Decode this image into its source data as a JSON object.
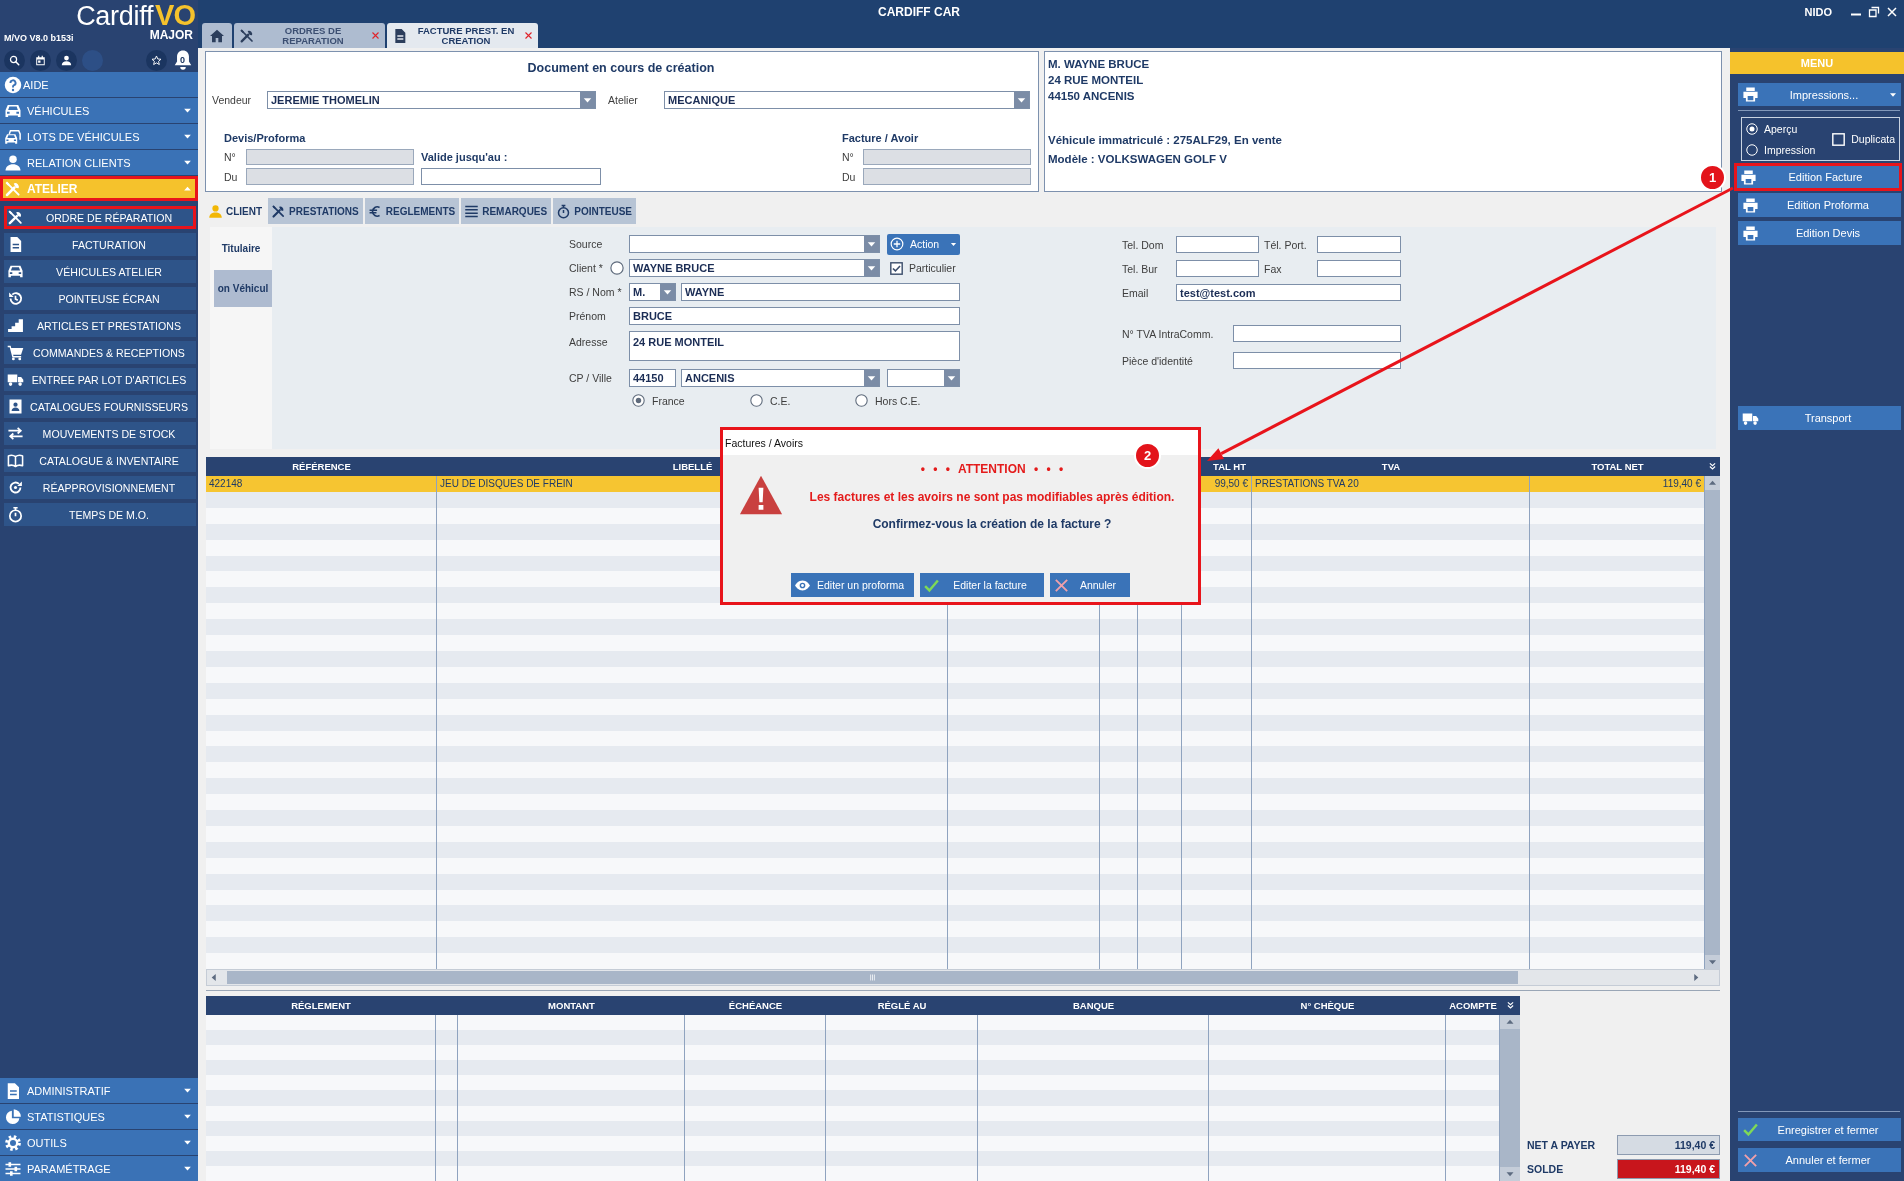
{
  "window": {
    "title": "CARDIFF CAR",
    "user": "NIDO"
  },
  "sidebar": {
    "logo": {
      "name": "Cardiff",
      "accent": "VO",
      "edition": "MAJOR"
    },
    "version": "M/VO V8.0 b153i",
    "notification_count": "0",
    "menu": [
      {
        "kind": "link",
        "label": "AIDE",
        "highlighted": false
      },
      {
        "kind": "group",
        "label": "VÉHICULES",
        "expanded": false,
        "highlighted": false
      },
      {
        "kind": "group",
        "label": "LOTS DE VÉHICULES",
        "expanded": false,
        "highlighted": false
      },
      {
        "kind": "group",
        "label": "RELATION CLIENTS",
        "expanded": false,
        "highlighted": false
      },
      {
        "kind": "group",
        "label": "ATELIER",
        "expanded": true,
        "highlighted": true,
        "children": [
          {
            "label": "ORDRE DE RÉPARATION",
            "highlighted": true
          },
          {
            "label": "FACTURATION",
            "highlighted": false
          },
          {
            "label": "VÉHICULES ATELIER",
            "highlighted": false
          },
          {
            "label": "POINTEUSE ÉCRAN",
            "highlighted": false
          },
          {
            "label": "ARTICLES ET PRESTATIONS",
            "highlighted": false
          },
          {
            "label": "COMMANDES & RECEPTIONS",
            "highlighted": false
          },
          {
            "label": "ENTREE PAR LOT D'ARTICLES",
            "highlighted": false
          },
          {
            "label": "CATALOGUES FOURNISSEURS",
            "highlighted": false
          },
          {
            "label": "MOUVEMENTS DE STOCK",
            "highlighted": false
          },
          {
            "label": "CATALOGUE & INVENTAIRE",
            "highlighted": false
          },
          {
            "label": "RÉAPPROVISIONNEMENT",
            "highlighted": false
          },
          {
            "label": "TEMPS DE M.O.",
            "highlighted": false
          }
        ]
      }
    ],
    "bottom_menu": [
      {
        "kind": "group",
        "label": "ADMINISTRATIF",
        "expanded": false,
        "highlighted": false
      },
      {
        "kind": "group",
        "label": "STATISTIQUES",
        "expanded": false,
        "highlighted": false
      },
      {
        "kind": "group",
        "label": "OUTILS",
        "expanded": false,
        "highlighted": false
      },
      {
        "kind": "group",
        "label": "PARAMÉTRAGE",
        "expanded": false,
        "highlighted": false
      }
    ]
  },
  "tabs": [
    {
      "kind": "home",
      "selected": false
    },
    {
      "kind": "document",
      "label": "ORDRES DE REPARATION",
      "selected": false
    },
    {
      "kind": "document",
      "label": "FACTURE PREST. EN CREATION",
      "selected": true
    }
  ],
  "document": {
    "title": "Document en cours de création",
    "seller": {
      "label": "Vendeur",
      "value": "JEREMIE THOMELIN"
    },
    "workshop": {
      "label": "Atelier",
      "value": "MECANIQUE"
    },
    "quote": {
      "title": "Devis/Proforma",
      "number": {
        "label": "N°",
        "disabled": true
      },
      "date": {
        "label": "Du",
        "disabled": true
      },
      "valid_until": {
        "label": "Valide jusqu'au :",
        "disabled": false
      }
    },
    "invoice": {
      "title": "Facture / Avoir",
      "number": {
        "label": "N°",
        "disabled": true
      },
      "date": {
        "label": "Du",
        "disabled": true
      }
    }
  },
  "client_info": {
    "address_lines": [
      "M. WAYNE BRUCE",
      "24 RUE MONTEIL",
      "44150 ANCENIS"
    ],
    "vehicle_lines": [
      "Véhicule immatriculé : 275ALF29, En vente",
      "Modèle : VOLKSWAGEN GOLF V"
    ]
  },
  "section_tabs": [
    {
      "label": "CLIENT",
      "selected": true
    },
    {
      "label": "PRESTATIONS",
      "selected": false
    },
    {
      "label": "REGLEMENTS",
      "selected": false
    },
    {
      "label": "REMARQUES",
      "selected": false
    },
    {
      "label": "POINTEUSE",
      "selected": false
    }
  ],
  "client_form": {
    "side_tabs": [
      {
        "label": "Titulaire",
        "selected": true
      },
      {
        "label": "on Véhicul",
        "selected": false
      }
    ],
    "source": {
      "label": "Source"
    },
    "action_button": {
      "label": "Action"
    },
    "client": {
      "label": "Client *",
      "radio_selected": false,
      "value": "WAYNE BRUCE"
    },
    "individual": {
      "label": "Particulier",
      "checked": true
    },
    "name": {
      "label": "RS / Nom *",
      "civility": "M.",
      "value": "WAYNE"
    },
    "first_name": {
      "label": "Prénom",
      "value": "BRUCE"
    },
    "address": {
      "label": "Adresse",
      "value": "24 RUE MONTEIL"
    },
    "city": {
      "label": "CP / Ville",
      "postcode": "44150",
      "value": "ANCENIS"
    },
    "zone": [
      {
        "label": "France",
        "selected": true
      },
      {
        "label": "C.E.",
        "selected": false
      },
      {
        "label": "Hors C.E.",
        "selected": false
      }
    ],
    "phone_home": {
      "label": "Tel. Dom"
    },
    "phone_mobile": {
      "label": "Tél. Port."
    },
    "phone_work": {
      "label": "Tel. Bur"
    },
    "fax": {
      "label": "Fax"
    },
    "email": {
      "label": "Email",
      "value": "test@test.com"
    },
    "vat_number": {
      "label": "N° TVA IntraComm."
    },
    "id_document": {
      "label": "Pièce d'identité"
    }
  },
  "lines_table": {
    "columns": [
      "RÉFÉRENCE",
      "LIBELLÉ",
      null,
      null,
      null,
      "TAL HT",
      "TVA",
      "TOTAL NET"
    ],
    "rows": [
      {
        "selected": true,
        "cells": [
          "422148",
          "JEU DE DISQUES DE FREIN",
          null,
          null,
          null,
          "99,50 €",
          "PRESTATIONS TVA 20",
          "119,40 €"
        ]
      }
    ]
  },
  "payments_table": {
    "columns": [
      "RÉGLEMENT",
      null,
      "MONTANT",
      "ÉCHÉANCE",
      "RÉGLÉ AU",
      "BANQUE",
      "N° CHÈQUE",
      "ACOMPTE"
    ]
  },
  "totals": [
    {
      "label": "NET A PAYER",
      "value": "119,40 €",
      "color": "#d5dbe3"
    },
    {
      "label": "SOLDE",
      "value": "119,40 €",
      "color": "#c8151c"
    }
  ],
  "menu_panel": {
    "title": "MENU",
    "print_button": {
      "label": "Impressions..."
    },
    "print_mode": [
      {
        "label": "Aperçu",
        "selected": true
      },
      {
        "label": "Impression",
        "selected": false
      }
    ],
    "duplicate": {
      "label": "Duplicata",
      "checked": false
    },
    "actions": [
      {
        "label": "Edition Facture",
        "highlighted": true,
        "badge": "1"
      },
      {
        "label": "Edition Proforma",
        "highlighted": false
      },
      {
        "label": "Edition Devis",
        "highlighted": false
      }
    ],
    "transport_button": {
      "label": "Transport"
    },
    "footer_buttons": [
      {
        "kind": "save",
        "label": "Enregistrer et fermer"
      },
      {
        "kind": "cancel",
        "label": "Annuler et fermer"
      }
    ]
  },
  "dialog": {
    "title": "Factures / Avoirs",
    "heading": "• • • ATTENTION • • •",
    "warning": "Les factures et les avoirs ne sont pas modifiables après édition.",
    "question": "Confirmez-vous la création de la facture ?",
    "buttons": [
      {
        "kind": "preview",
        "label": "Editer un proforma"
      },
      {
        "kind": "confirm",
        "label": "Editer la facture"
      },
      {
        "kind": "cancel",
        "label": "Annuler"
      }
    ],
    "highlighted": true,
    "badge": "2"
  },
  "callout_arrow": true
}
